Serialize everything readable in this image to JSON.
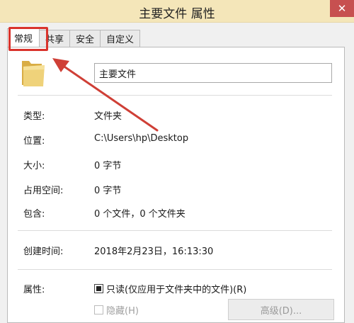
{
  "window": {
    "title": "主要文件 属性",
    "close_label": "✕"
  },
  "tabs": [
    {
      "label": "常规",
      "active": true
    },
    {
      "label": "共享",
      "active": false
    },
    {
      "label": "安全",
      "active": false
    },
    {
      "label": "自定义",
      "active": false
    }
  ],
  "general": {
    "name_value": "主要文件",
    "rows": [
      {
        "label": "类型:",
        "value": "文件夹"
      },
      {
        "label": "位置:",
        "value": "C:\\Users\\hp\\Desktop"
      },
      {
        "label": "大小:",
        "value": "0 字节"
      },
      {
        "label": "占用空间:",
        "value": "0 字节"
      },
      {
        "label": "包含:",
        "value": "0 个文件，0 个文件夹"
      },
      {
        "label": "创建时间:",
        "value": "2018年2月23日，16:13:30"
      }
    ],
    "attributes_label": "属性:",
    "readonly_label": "只读(仅应用于文件夹中的文件)(R)",
    "hidden_label": "隐藏(H)",
    "advanced_button": "高级(D)..."
  },
  "colors": {
    "titlebar_bg": "#f4e6b9",
    "highlight": "#d9332c",
    "folder": "#e8c46a"
  },
  "icons": {
    "folder": "folder-icon",
    "close": "close-icon",
    "arrow": "annotation-arrow-icon"
  }
}
